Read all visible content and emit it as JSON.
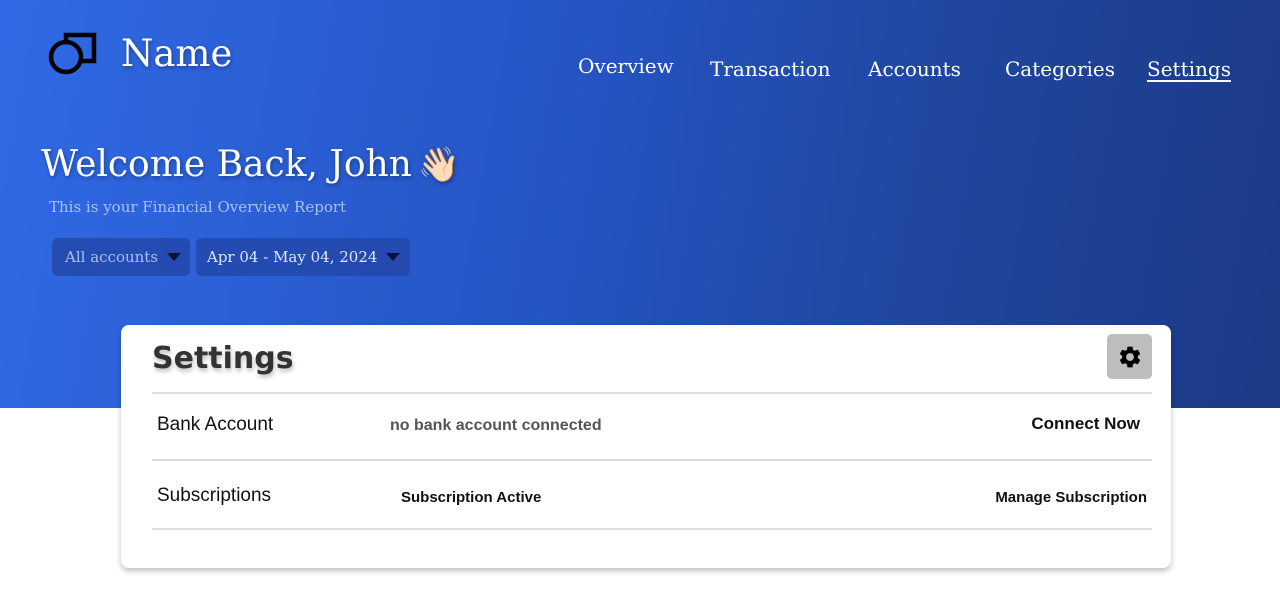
{
  "header": {
    "brand": "Name",
    "logo_icon": "shapes-logo-icon",
    "nav": [
      {
        "label": "Overview",
        "active": false
      },
      {
        "label": "Transaction",
        "active": false
      },
      {
        "label": "Accounts",
        "active": false
      },
      {
        "label": "Categories",
        "active": false
      },
      {
        "label": "Settings",
        "active": true
      }
    ]
  },
  "hero": {
    "welcome": "Welcome Back, John",
    "wave_emoji": "👋🏻",
    "subtitle": "This is your Financial Overview Report",
    "filters": {
      "account": "All accounts",
      "date_range": "Apr 04 - May 04, 2024"
    }
  },
  "settings_card": {
    "title": "Settings",
    "gear_icon": "gear-icon",
    "rows": [
      {
        "label": "Bank Account",
        "status": "no bank account connected",
        "action": "Connect Now"
      },
      {
        "label": "Subscriptions",
        "status": "Subscription Active",
        "action": "Manage Subscription"
      }
    ]
  },
  "colors": {
    "hero_gradient_start": "#306ae6",
    "hero_gradient_end": "#1c3a85",
    "card_background": "#ffffff",
    "gear_button_background": "#bdbdbd"
  }
}
